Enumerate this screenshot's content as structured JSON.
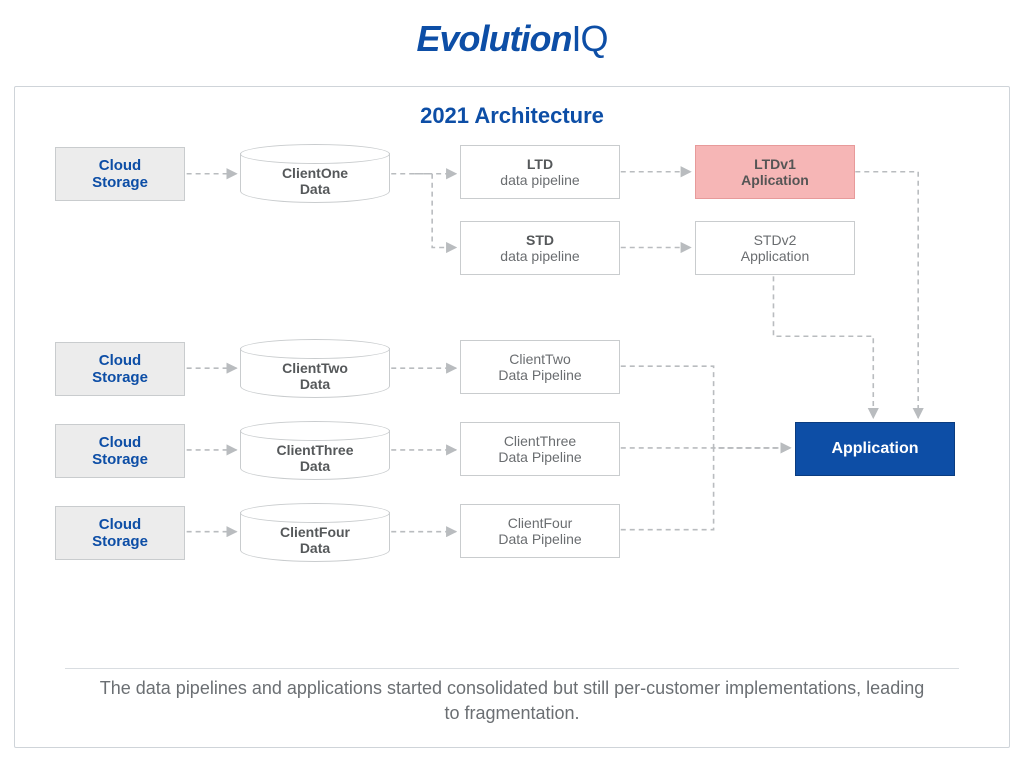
{
  "logo": {
    "left": "Evolution",
    "right": "IQ"
  },
  "title": "2021 Architecture",
  "caption": "The data pipelines and applications started consolidated but still per-customer implementations, leading to fragmentation.",
  "storage_label": "Cloud\nStorage",
  "dbs": {
    "c1": "ClientOne\nData",
    "c2": "ClientTwo\nData",
    "c3": "ClientThree\nData",
    "c4": "ClientFour\nData"
  },
  "pipes": {
    "ltd_title": "LTD",
    "ltd_sub": "data pipeline",
    "std_title": "STD",
    "std_sub": "data pipeline",
    "c2": "ClientTwo\nData Pipeline",
    "c3": "ClientThree\nData Pipeline",
    "c4": "ClientFour\nData Pipeline"
  },
  "apps": {
    "ltdv1": "LTDv1\nAplication",
    "stdv2": "STDv2\nApplication",
    "shared": "Application"
  }
}
